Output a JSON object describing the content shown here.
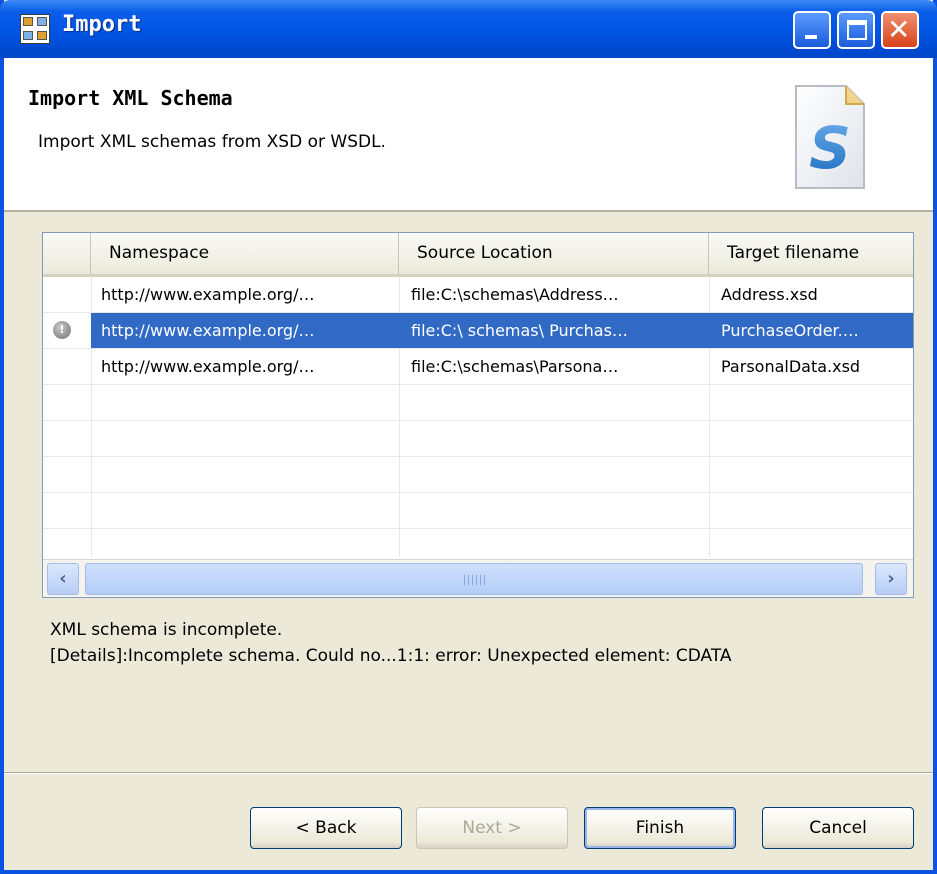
{
  "window": {
    "title": "Import"
  },
  "header": {
    "title": "Import XML Schema",
    "description": "Import XML schemas from XSD or WSDL."
  },
  "table": {
    "columns": [
      "",
      "Namespace",
      "Source Location",
      "Target filename"
    ],
    "rows": [
      {
        "status": "",
        "namespace": "http://www.example.org/…",
        "source": "file:C:\\schemas\\Address…",
        "target": "Address.xsd",
        "selected": false
      },
      {
        "status": "warning",
        "namespace": "http://www.example.org/…",
        "source": "file:C:\\ schemas\\ Purchas…",
        "target": "PurchaseOrder.…",
        "selected": true
      },
      {
        "status": "",
        "namespace": "http://www.example.org/…",
        "source": "file:C:\\schemas\\Parsona…",
        "target": "ParsonalData.xsd",
        "selected": false
      }
    ]
  },
  "status": {
    "line1": "XML schema is incomplete.",
    "line2": "[Details]:Incomplete schema. Could no...1:1: error: Unexpected element: CDATA"
  },
  "buttons": {
    "back": "< Back",
    "next": "Next >",
    "finish": "Finish",
    "cancel": "Cancel"
  },
  "icons": {
    "app": "import-wizard-icon",
    "header": "schema-document-icon",
    "row_status": "warning-icon"
  },
  "colors": {
    "titlebar": "#0054e3",
    "selection": "#316ac5",
    "close": "#d8421a"
  }
}
